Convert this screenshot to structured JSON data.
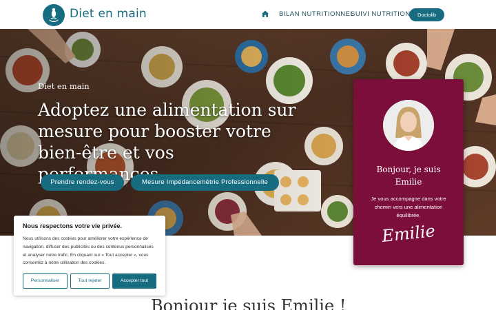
{
  "header": {
    "brand": "Diet en main",
    "nav": {
      "home_icon": "home-icon",
      "bilan": "BILAN NUTRITIONNEL",
      "suivi": "SUIVI NUTRITION",
      "doctolib": "Doctolib"
    }
  },
  "hero": {
    "eyebrow": "Diet en main",
    "title": "Adoptez une alimentation sur mesure pour booster votre bien-être et vos performances.",
    "buttons": {
      "rdv": "Prendre rendez-vous",
      "impedance": "Mesure Impédancemétrie Professionnelle"
    }
  },
  "card": {
    "hello_line1": "Bonjour, je suis",
    "hello_line2": "Emilie",
    "text": "Je vous accompagne dans votre chemin vers une alimentation équilibrée.",
    "signature": "Emilie"
  },
  "cookie": {
    "title": "Nous respectons votre vie privée.",
    "text": "Nous utilisons des cookies pour améliorer votre expérience de navigation, diffuser des publicités ou des contenus personnalisés et analyser notre trafic. En cliquant sur « Tout accepter », vous consentez à notre utilisation des cookies.",
    "buttons": {
      "customize": "Personnaliser",
      "reject": "Tout rejeter",
      "accept": "Accepter tout"
    }
  },
  "section": {
    "title": "Bonjour je suis Emilie !"
  },
  "colors": {
    "brand": "#176c80",
    "card": "#7b0e3b"
  }
}
